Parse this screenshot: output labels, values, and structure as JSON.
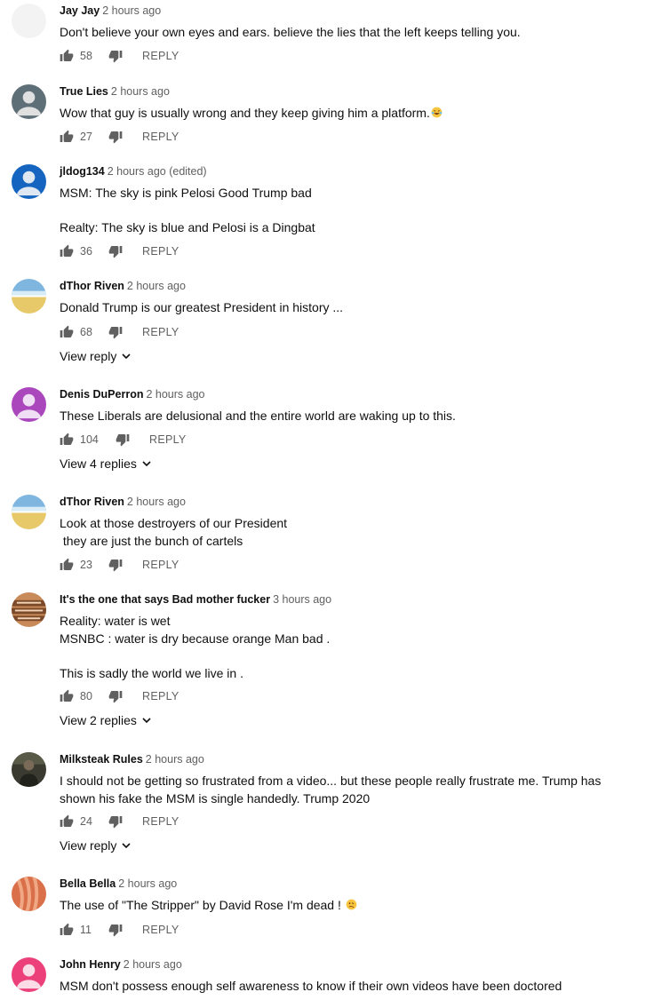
{
  "comments": [
    {
      "author": "Jay Jay",
      "time": "2 hours ago",
      "text": "Don't believe your own eyes and ears. believe the lies that the left keeps telling you.",
      "likes": "58",
      "reply": "REPLY",
      "avatar_color": "#f2f2f2"
    },
    {
      "author": "True Lies",
      "time": "2 hours ago",
      "text": "Wow that guy is usually wrong and they keep giving him a platform.",
      "emoji": "laughing-face-icon",
      "likes": "27",
      "reply": "REPLY",
      "avatar_color": "#5f6f78"
    },
    {
      "author": "jldog134",
      "time": "2 hours ago (edited)",
      "text": "MSM: The sky is pink Pelosi Good Trump bad\n\nRealty: The sky is blue and Pelosi is a Dingbat",
      "likes": "36",
      "reply": "REPLY",
      "avatar_color": "#1565c0"
    },
    {
      "author": "dThor Riven",
      "time": "2 hours ago",
      "text": "Donald Trump is our greatest President in history ...",
      "likes": "68",
      "reply": "REPLY",
      "view_replies": "View reply",
      "avatar_color": "#7fb6e0"
    },
    {
      "author": "Denis DuPerron",
      "time": "2 hours ago",
      "text": "These Liberals are delusional and the entire world are waking up to this.",
      "likes": "104",
      "reply": "REPLY",
      "view_replies": "View 4 replies",
      "avatar_color": "#ab47bc"
    },
    {
      "author": "dThor Riven",
      "time": "2 hours ago",
      "text": "Look at those destroyers of our President\n they are just the bunch of cartels",
      "likes": "23",
      "reply": "REPLY",
      "avatar_color": "#7fb6e0"
    },
    {
      "author": "It's the one that says Bad mother fucker",
      "time": "3 hours ago",
      "text": "Reality: water is wet\nMSNBC : water is dry because orange Man bad .\n\nThis is sadly the world we live in .",
      "likes": "80",
      "reply": "REPLY",
      "view_replies": "View 2 replies",
      "avatar_color": "#c98a5a"
    },
    {
      "author": "Milksteak Rules",
      "time": "2 hours ago",
      "text": "I should not be getting so frustrated from a video... but these people really frustrate me. Trump has\nshown his fake the MSM is single handedly. Trump 2020",
      "likes": "24",
      "reply": "REPLY",
      "view_replies": "View reply",
      "avatar_color": "#3a3a30"
    },
    {
      "author": "Bella Bella",
      "time": "2 hours ago",
      "text": "The use of \"The Stripper\" by David Rose I'm dead ! ",
      "emoji": "woozy-face-icon",
      "likes": "11",
      "reply": "REPLY",
      "avatar_color": "#d9704a"
    },
    {
      "author": "John Henry",
      "time": "2 hours ago",
      "text": "MSM don't possess enough self awareness to know if their own videos have been doctored",
      "avatar_color": "#ec407a"
    }
  ]
}
